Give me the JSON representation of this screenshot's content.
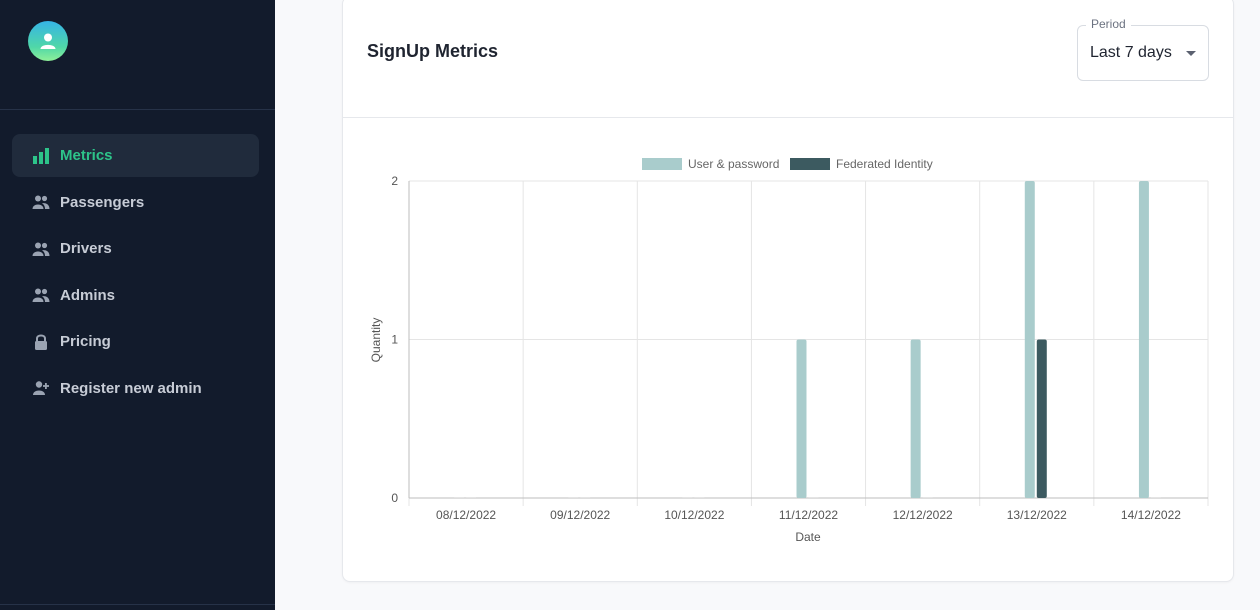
{
  "sidebar": {
    "avatar_icon": "user-icon",
    "items": [
      {
        "label": "Metrics",
        "icon": "bar-chart-icon",
        "active": true
      },
      {
        "label": "Passengers",
        "icon": "people-icon",
        "active": false
      },
      {
        "label": "Drivers",
        "icon": "people-icon",
        "active": false
      },
      {
        "label": "Admins",
        "icon": "people-icon",
        "active": false
      },
      {
        "label": "Pricing",
        "icon": "lock-icon",
        "active": false
      },
      {
        "label": "Register new admin",
        "icon": "person-add-icon",
        "active": false
      }
    ]
  },
  "card": {
    "title": "SignUp Metrics",
    "period": {
      "label": "Period",
      "value": "Last 7 days"
    }
  },
  "colors": {
    "sidebar_bg": "#121b2c",
    "accent": "#2dc48a",
    "series_user_password": "#a9cccc",
    "series_federated": "#3c5a60"
  },
  "chart_data": {
    "type": "bar",
    "categories": [
      "08/12/2022",
      "09/12/2022",
      "10/12/2022",
      "11/12/2022",
      "12/12/2022",
      "13/12/2022",
      "14/12/2022"
    ],
    "series": [
      {
        "name": "User & password",
        "values": [
          0,
          0,
          0,
          1,
          1,
          2,
          2
        ]
      },
      {
        "name": "Federated Identity",
        "values": [
          0,
          0,
          0,
          0,
          0,
          1,
          0
        ]
      }
    ],
    "xlabel": "Date",
    "ylabel": "Quantity",
    "ylim": [
      0,
      2
    ],
    "yticks": [
      0,
      1,
      2
    ],
    "grid": true,
    "legend": "top"
  }
}
